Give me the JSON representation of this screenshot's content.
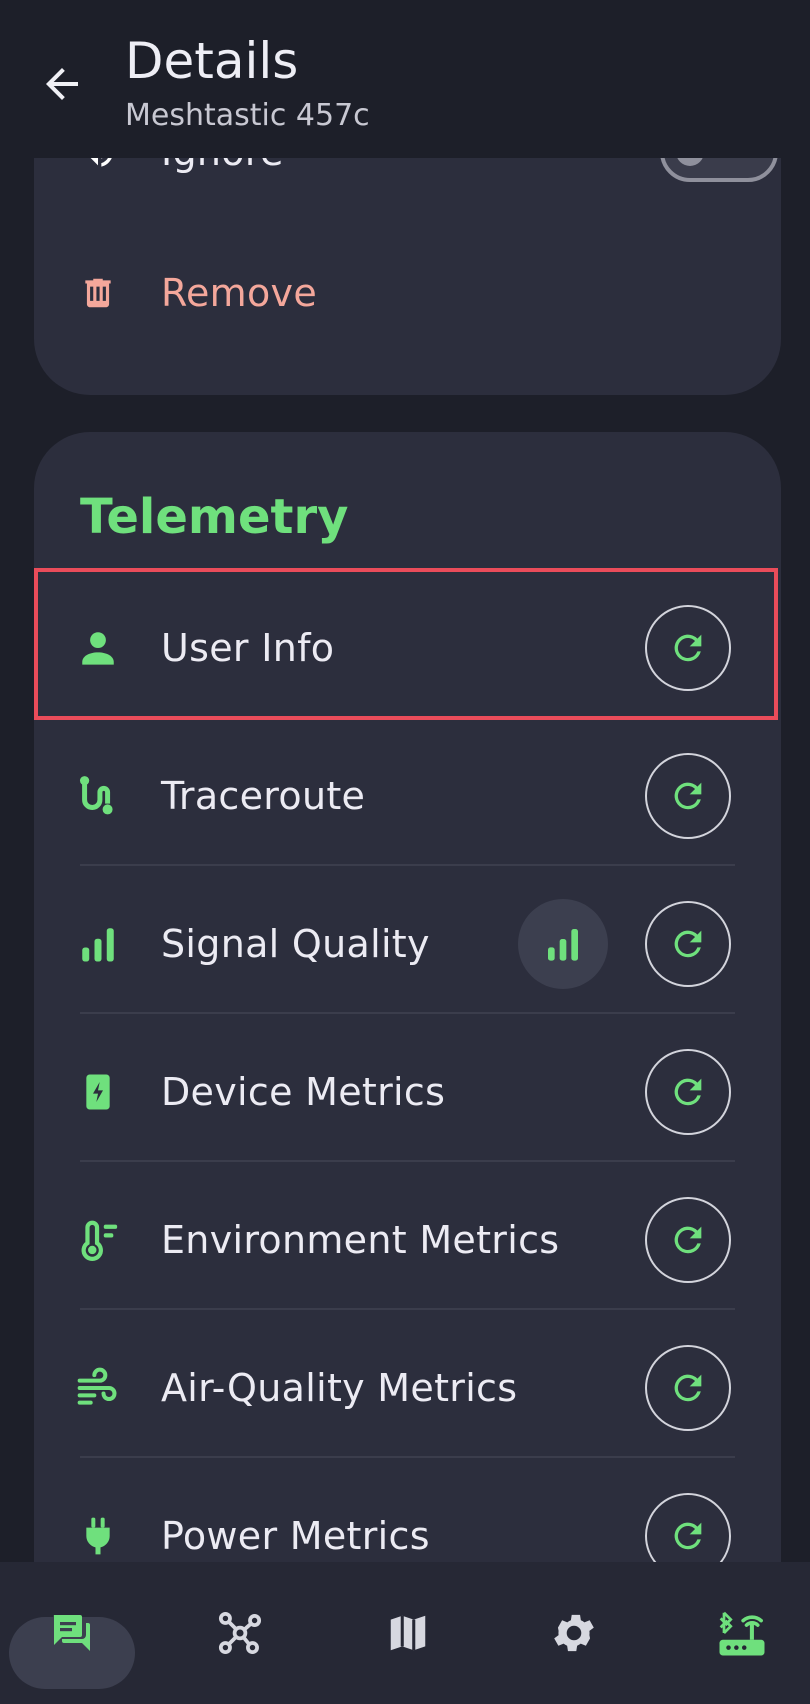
{
  "header": {
    "title": "Details",
    "subtitle": "Meshtastic 457c"
  },
  "actions": {
    "ignore_label": "Ignore",
    "remove_label": "Remove",
    "ignore_enabled": false
  },
  "telemetry": {
    "title": "Telemetry",
    "items": [
      {
        "label": "User Info",
        "icon": "person-icon"
      },
      {
        "label": "Traceroute",
        "icon": "route-icon"
      },
      {
        "label": "Signal Quality",
        "icon": "signal-icon"
      },
      {
        "label": "Device Metrics",
        "icon": "battery-charging-icon"
      },
      {
        "label": "Environment Metrics",
        "icon": "thermometer-icon"
      },
      {
        "label": "Air-Quality Metrics",
        "icon": "air-icon"
      },
      {
        "label": "Power Metrics",
        "icon": "plug-icon"
      }
    ]
  },
  "nav": {
    "items": [
      {
        "icon": "chat-icon",
        "selected": true
      },
      {
        "icon": "nodes-icon",
        "selected": false
      },
      {
        "icon": "map-icon",
        "selected": false
      },
      {
        "icon": "settings-icon",
        "selected": false
      },
      {
        "icon": "router-bluetooth-icon",
        "selected": false
      }
    ]
  },
  "colors": {
    "accent": "#6fe07d",
    "danger": "#f4a79b",
    "background": "#1d1f29",
    "card": "#2c2e3d",
    "highlight": "#ea4c5a"
  }
}
